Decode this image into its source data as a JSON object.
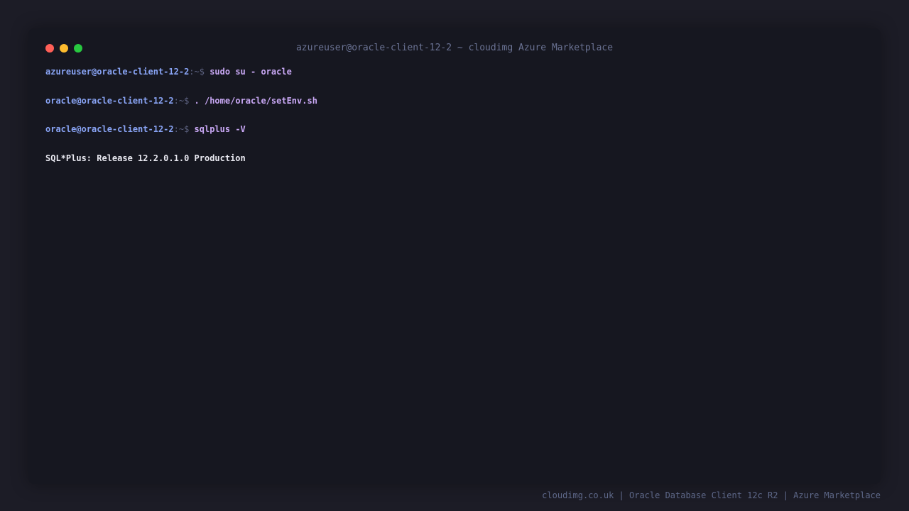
{
  "window": {
    "title": "azureuser@oracle-client-12-2 ~ cloudimg Azure Marketplace"
  },
  "terminal": {
    "lines": [
      {
        "prompt_user": "azureuser@oracle-client-12-2",
        "prompt_sep": ":~$ ",
        "command": "sudo su - oracle"
      },
      {
        "prompt_user": "oracle@oracle-client-12-2",
        "prompt_sep": ":~$ ",
        "command": ". /home/oracle/setEnv.sh"
      },
      {
        "prompt_user": "oracle@oracle-client-12-2",
        "prompt_sep": ":~$ ",
        "command": "sqlplus -V"
      }
    ],
    "output": "SQL*Plus: Release 12.2.0.1.0 Production"
  },
  "footer": {
    "text": "cloudimg.co.uk | Oracle Database Client 12c R2 | Azure Marketplace"
  },
  "colors": {
    "background": "#1c1c26",
    "window": "#161720",
    "prompt": "#89a4f5",
    "command": "#c9a8f5",
    "output": "#e8e8f0",
    "close": "#ff5f57",
    "minimize": "#febc2e",
    "maximize": "#28c840"
  }
}
